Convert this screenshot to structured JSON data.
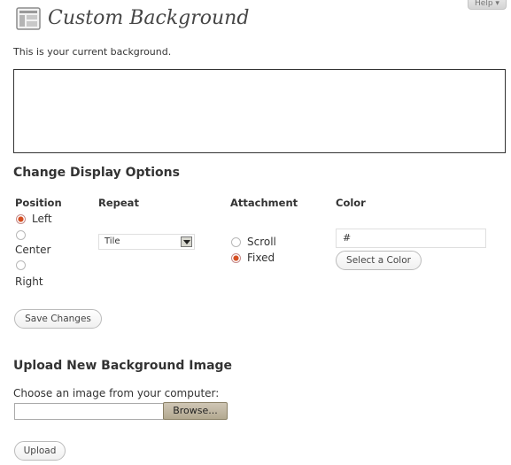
{
  "help_tab": {
    "label": "Help"
  },
  "header": {
    "title": "Custom Background"
  },
  "current_background": {
    "text": "This is your current background."
  },
  "display_options": {
    "heading": "Change Display Options",
    "position": {
      "label": "Position",
      "options": [
        "Left",
        "Center",
        "Right"
      ],
      "selected": "Left"
    },
    "repeat": {
      "label": "Repeat",
      "selected": "Tile"
    },
    "attachment": {
      "label": "Attachment",
      "options": [
        "Scroll",
        "Fixed"
      ],
      "selected": "Fixed"
    },
    "color": {
      "label": "Color",
      "value": "#",
      "select_button": "Select a Color"
    },
    "save_button": "Save Changes"
  },
  "upload": {
    "heading": "Upload New Background Image",
    "choose_label": "Choose an image from your computer:",
    "browse_button": "Browse...",
    "upload_button": "Upload"
  },
  "colors": {
    "radio_checked": "#d54e21",
    "text": "#333333",
    "title": "#464646",
    "browse_bg": "#c2b9a4"
  }
}
